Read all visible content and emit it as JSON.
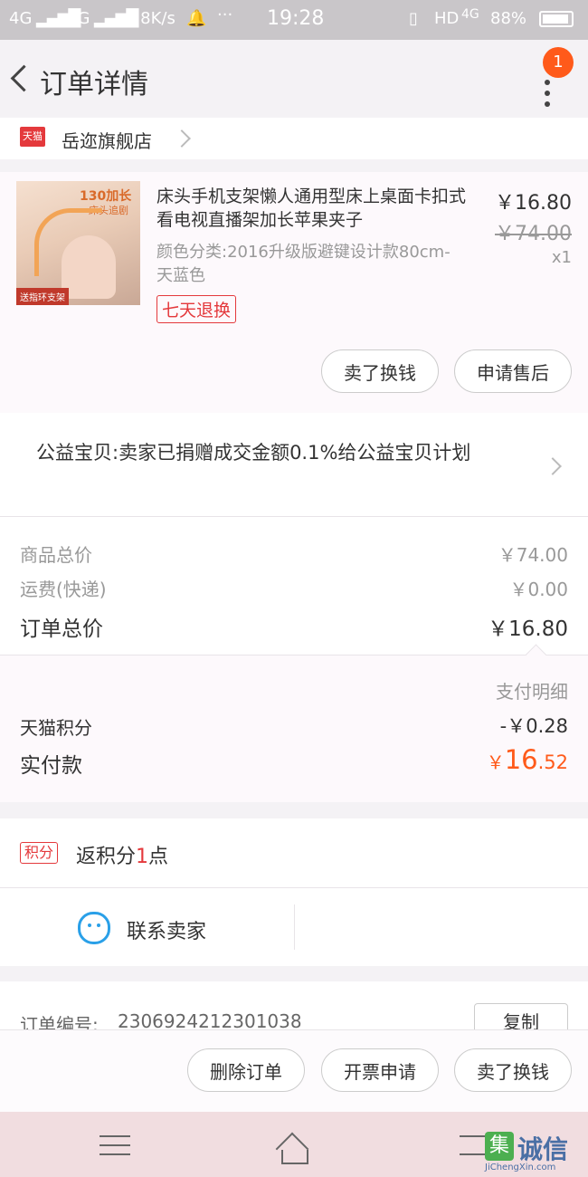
{
  "status_bar": {
    "network1": "4G",
    "network2": "3G",
    "speed": "6.8K/s",
    "dots": "···",
    "time": "19:28",
    "hd": "HD",
    "network3": "4G",
    "battery": "88%"
  },
  "header": {
    "title": "订单详情",
    "badge": "1"
  },
  "store": {
    "badge": "天猫",
    "name": "岳迩旗舰店"
  },
  "product": {
    "image_text_top": "130加长",
    "image_text_sub": "床头追剧",
    "image_text_bottom": "送指环支架",
    "title": "床头手机支架懒人通用型床上桌面卡扣式看电视直播架加长苹果夹子",
    "variant": "颜色分类:2016升级版避键设计款80cm-天蓝色",
    "tag": "七天退换",
    "price": "￥16.80",
    "original_price": "￥74.00",
    "quantity": "x1",
    "sell_button": "卖了换钱",
    "aftersale_button": "申请售后"
  },
  "charity": {
    "text": "公益宝贝:卖家已捐赠成交金额0.1%给公益宝贝计划"
  },
  "summary": {
    "goods_total_label": "商品总价",
    "goods_total_value": "￥74.00",
    "shipping_label": "运费(快递)",
    "shipping_value": "￥0.00",
    "order_total_label": "订单总价",
    "order_total_value": "￥16.80",
    "payment_detail_label": "支付明细",
    "points_label": "天猫积分",
    "points_value": "-￥0.28",
    "paid_label": "实付款",
    "paid_currency": "￥",
    "paid_integer": "16",
    "paid_decimal": ".52"
  },
  "rewards": {
    "badge": "积分",
    "text_prefix": "返积分",
    "points": "1",
    "text_suffix": "点"
  },
  "contact": {
    "label": "联系卖家"
  },
  "order_info": {
    "number_label": "订单编号:",
    "number_value": "2306924212301038",
    "copy_button": "复制"
  },
  "bottom_actions": {
    "delete": "删除订单",
    "invoice": "开票申请",
    "sell": "卖了换钱"
  },
  "watermark": {
    "brand": "诚信",
    "icon_char": "集",
    "url": "JiChengXin.com"
  },
  "colors": {
    "accent_orange": "#ff5a1a",
    "tag_red": "#e4393c",
    "nav_bar": "#f1dde0"
  }
}
